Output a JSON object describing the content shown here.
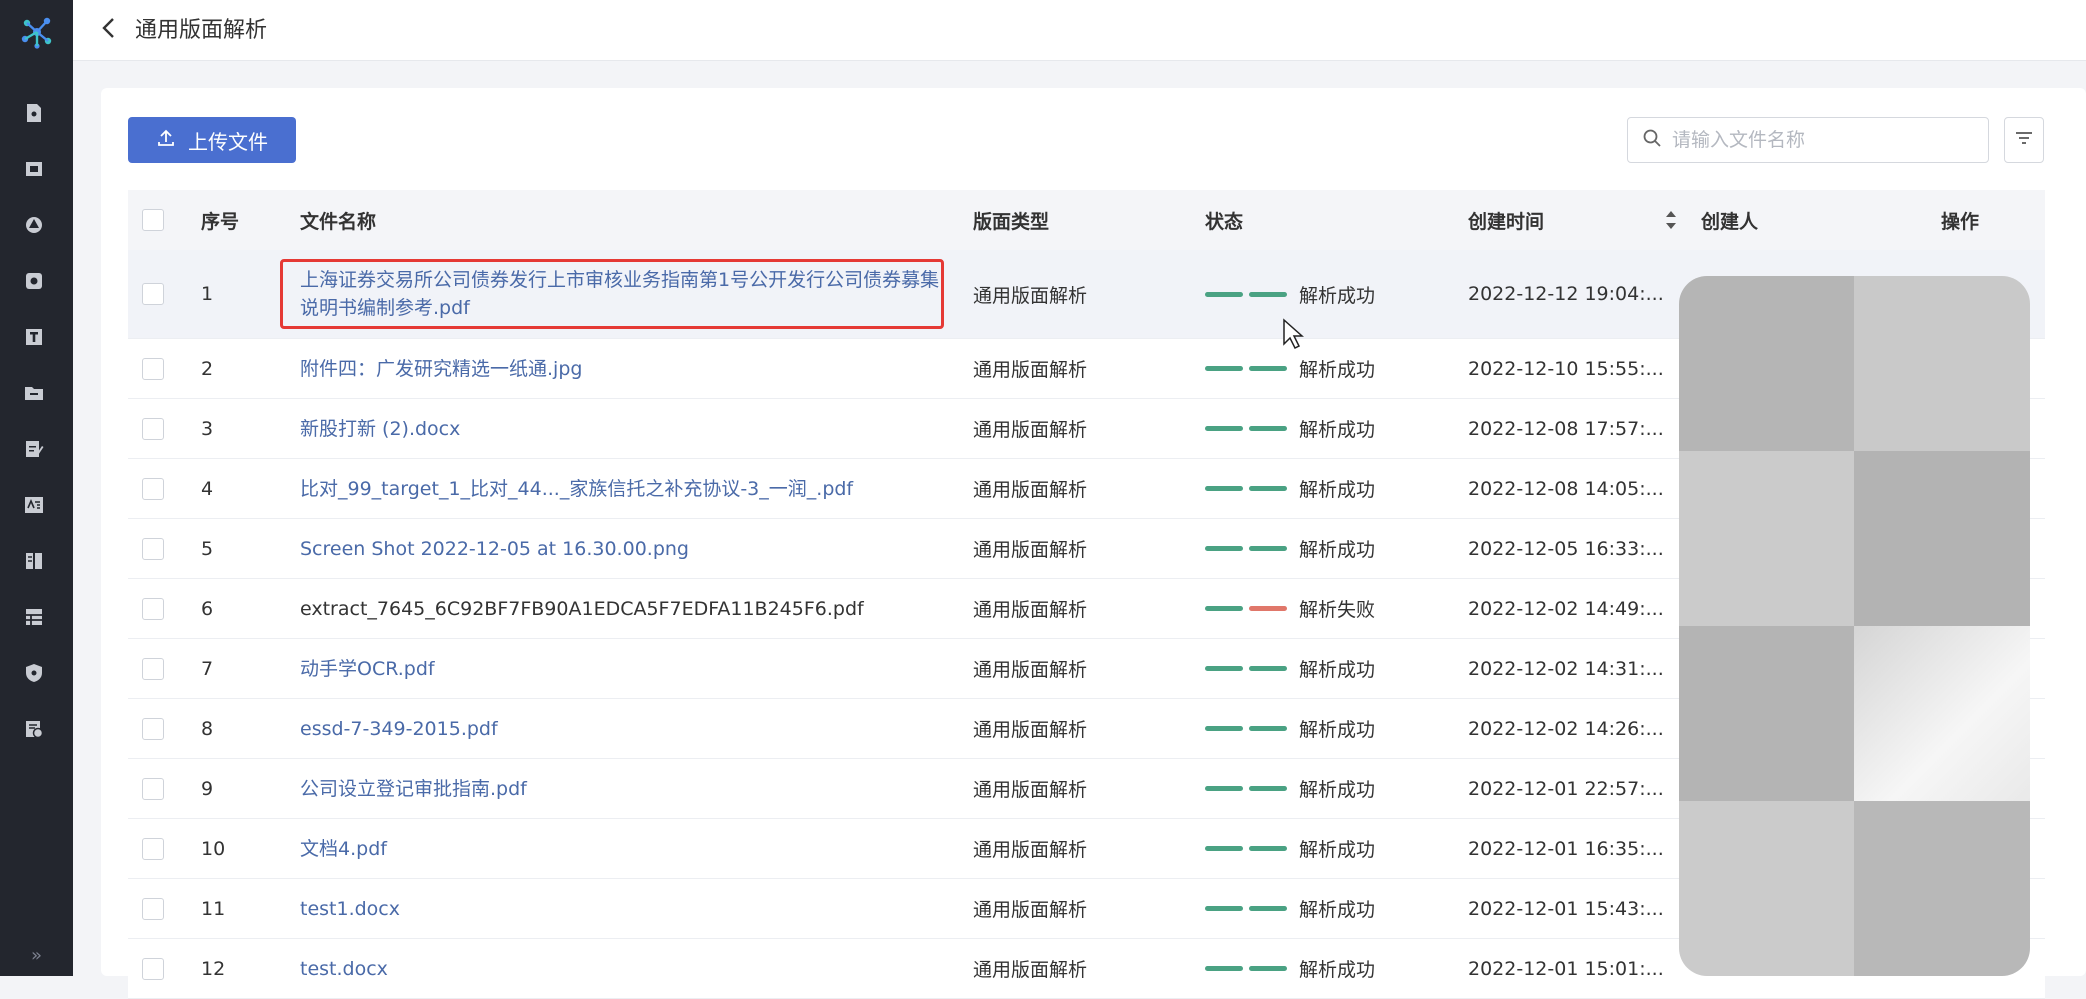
{
  "header": {
    "title": "通用版面解析"
  },
  "toolbar": {
    "upload_label": "上传文件",
    "search_placeholder": "请输入文件名称",
    "search_value": ""
  },
  "table": {
    "columns": {
      "index": "序号",
      "name": "文件名称",
      "type": "版面类型",
      "status": "状态",
      "created": "创建时间",
      "creator": "创建人",
      "ops": "操作"
    },
    "rows": [
      {
        "index": "1",
        "name": "上海证券交易所公司债券发行上市审核业务指南第1号公开发行公司债券募集说明书编制参考.pdf",
        "type": "通用版面解析",
        "status": "解析成功",
        "created": "2022-12-12 19:04:..."
      },
      {
        "index": "2",
        "name": "附件四：广发研究精选一纸通.jpg",
        "type": "通用版面解析",
        "status": "解析成功",
        "created": "2022-12-10 15:55:..."
      },
      {
        "index": "3",
        "name": "新股打新 (2).docx",
        "type": "通用版面解析",
        "status": "解析成功",
        "created": "2022-12-08 17:57:..."
      },
      {
        "index": "4",
        "name": "比对_99_target_1_比对_44..._家族信托之补充协议-3_一润_.pdf",
        "type": "通用版面解析",
        "status": "解析成功",
        "created": "2022-12-08 14:05:..."
      },
      {
        "index": "5",
        "name": "Screen Shot 2022-12-05 at 16.30.00.png",
        "type": "通用版面解析",
        "status": "解析成功",
        "created": "2022-12-05 16:33:..."
      },
      {
        "index": "6",
        "name": "extract_7645_6C92BF7FB90A1EDCA5F7EDFA11B245F6.pdf",
        "type": "通用版面解析",
        "status": "解析失败",
        "created": "2022-12-02 14:49:..."
      },
      {
        "index": "7",
        "name": "动手学OCR.pdf",
        "type": "通用版面解析",
        "status": "解析成功",
        "created": "2022-12-02 14:31:..."
      },
      {
        "index": "8",
        "name": "essd-7-349-2015.pdf",
        "type": "通用版面解析",
        "status": "解析成功",
        "created": "2022-12-02 14:26:..."
      },
      {
        "index": "9",
        "name": "公司设立登记审批指南.pdf",
        "type": "通用版面解析",
        "status": "解析成功",
        "created": "2022-12-01 22:57:..."
      },
      {
        "index": "10",
        "name": "文档4.pdf",
        "type": "通用版面解析",
        "status": "解析成功",
        "created": "2022-12-01 16:35:..."
      },
      {
        "index": "11",
        "name": "test1.docx",
        "type": "通用版面解析",
        "status": "解析成功",
        "created": "2022-12-01 15:43:..."
      },
      {
        "index": "12",
        "name": "test.docx",
        "type": "通用版面解析",
        "status": "解析成功",
        "created": "2022-12-01 15:01:..."
      }
    ]
  },
  "colors": {
    "accent": "#4a6fd0",
    "success": "#4aa283",
    "failure": "#e0776a",
    "sidebar": "#23262e",
    "highlight": "#e53935"
  },
  "icons": [
    "logo-icon",
    "back-icon",
    "upload-icon",
    "search-icon",
    "filter-icon",
    "sort-icon",
    "expand-sidebar-icon"
  ]
}
